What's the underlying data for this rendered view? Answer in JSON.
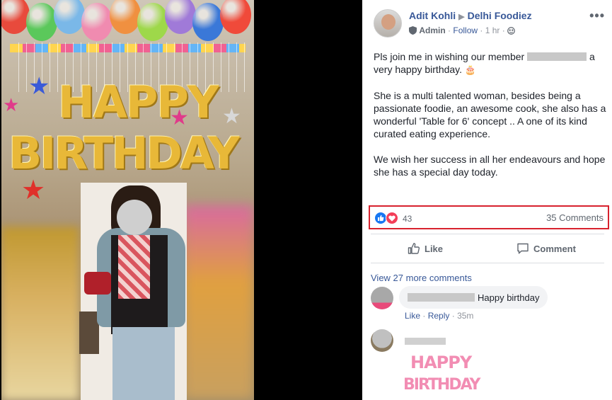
{
  "photo": {
    "banner_line1": "HAPPY",
    "banner_line2": "BIRTHDAY",
    "balloon_colors": [
      "#e84a3c",
      "#5bc85b",
      "#7ab8e8",
      "#f08bb0",
      "#f09040",
      "#9ed84a",
      "#a07ad8",
      "#3a78d8",
      "#f04a3a"
    ]
  },
  "post": {
    "author": "Adit Kohli",
    "group": "Delhi Foodiez",
    "role": "Admin",
    "follow": "Follow",
    "time": "1 hr",
    "body_p1_before": "Pls join me in wishing our member",
    "body_p1_after": "a very happy birthday.",
    "body_p1_emoji": "🎂",
    "body_p2": "She is a multi talented woman, besides being a passionate foodie, an awesome cook, she also has a wonderful 'Table for 6' concept .. A one of its kind curated eating experience.",
    "body_p3": "We wish her success in all her endeavours and hope she has a special day today."
  },
  "reactions": {
    "count": "43",
    "comments": "35 Comments"
  },
  "actions": {
    "like": "Like",
    "comment": "Comment"
  },
  "comments": {
    "view_more": "View 27 more comments",
    "c1_text": "Happy birthday",
    "c1_like": "Like",
    "c1_reply": "Reply",
    "c1_time": "35m",
    "c2_sticker_line1": "HAPPY",
    "c2_sticker_line2": "BIRTHDAY"
  },
  "colors": {
    "link": "#385898",
    "highlight": "#d8222e",
    "like": "#1877f2",
    "love": "#f33e58"
  },
  "icons": [
    "play-arrow-icon",
    "shield-icon",
    "globe-icon",
    "more-icon",
    "like-reaction-icon",
    "love-reaction-icon",
    "thumbs-up-icon",
    "comment-bubble-icon"
  ]
}
